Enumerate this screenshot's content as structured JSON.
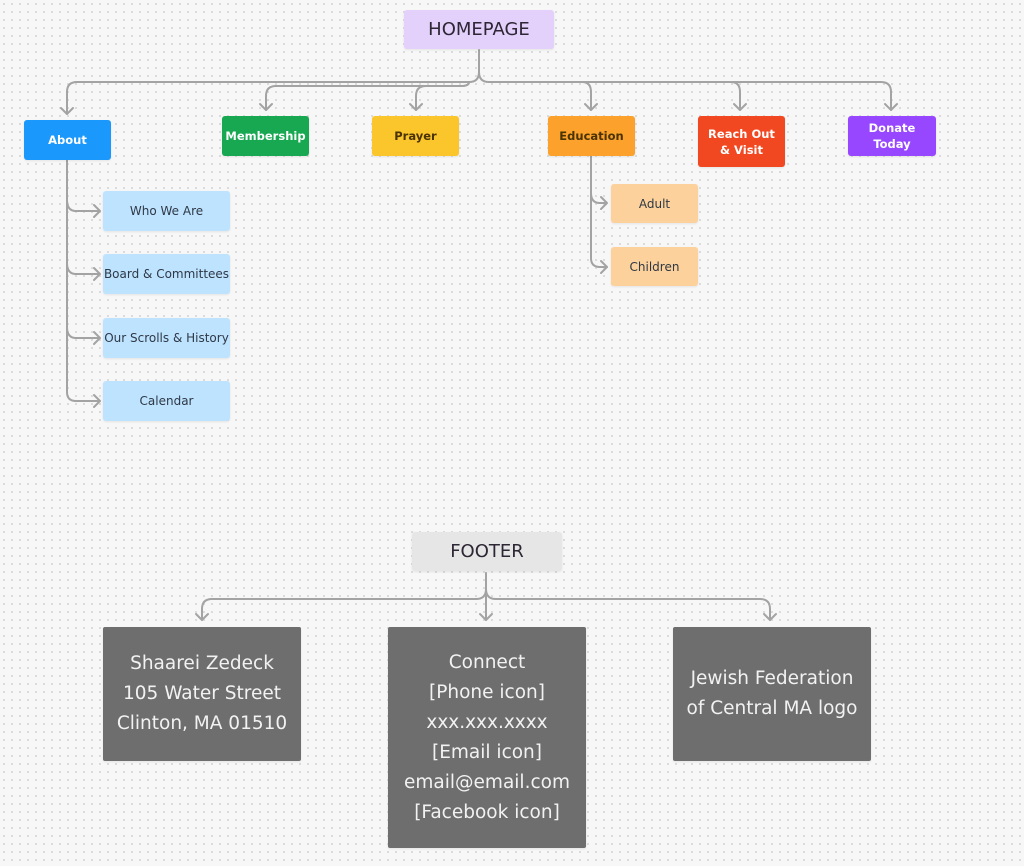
{
  "diagram": {
    "homepage": {
      "label": "HOMEPAGE",
      "color": "#e3d0fb"
    },
    "categories": [
      {
        "id": "about",
        "label": "About",
        "color": "#1a98fc"
      },
      {
        "id": "membership",
        "label": "Membership",
        "color": "#17a851"
      },
      {
        "id": "prayer",
        "label": "Prayer",
        "color": "#fbc52c"
      },
      {
        "id": "education",
        "label": "Education",
        "color": "#fba12c"
      },
      {
        "id": "reach-out",
        "label": "Reach Out & Visit",
        "line1": "Reach Out",
        "line2": "& Visit",
        "color": "#f24822"
      },
      {
        "id": "donate",
        "label": "Donate Today",
        "color": "#9747ff"
      }
    ],
    "about_children": {
      "color": "#bde3ff",
      "items": [
        "Who We Are",
        "Board & Committees",
        "Our Scrolls & History",
        "Calendar"
      ]
    },
    "education_children": {
      "color": "#fcd19c",
      "items": [
        "Adult",
        "Children"
      ]
    },
    "footer": {
      "label": "FOOTER",
      "color": "#e6e6e6",
      "boxes": [
        {
          "lines": [
            "Shaarei Zedeck",
            "105 Water Street",
            "Clinton, MA 01510"
          ]
        },
        {
          "lines": [
            "Connect",
            "[Phone icon]",
            "xxx.xxx.xxxx",
            "[Email icon]",
            "email@email.com",
            "[Facebook icon]"
          ]
        },
        {
          "lines": [
            "Jewish Federation",
            "of Central MA logo"
          ]
        }
      ],
      "box_color": "#6e6e6e"
    },
    "connector_color": "#a3a3a3"
  }
}
